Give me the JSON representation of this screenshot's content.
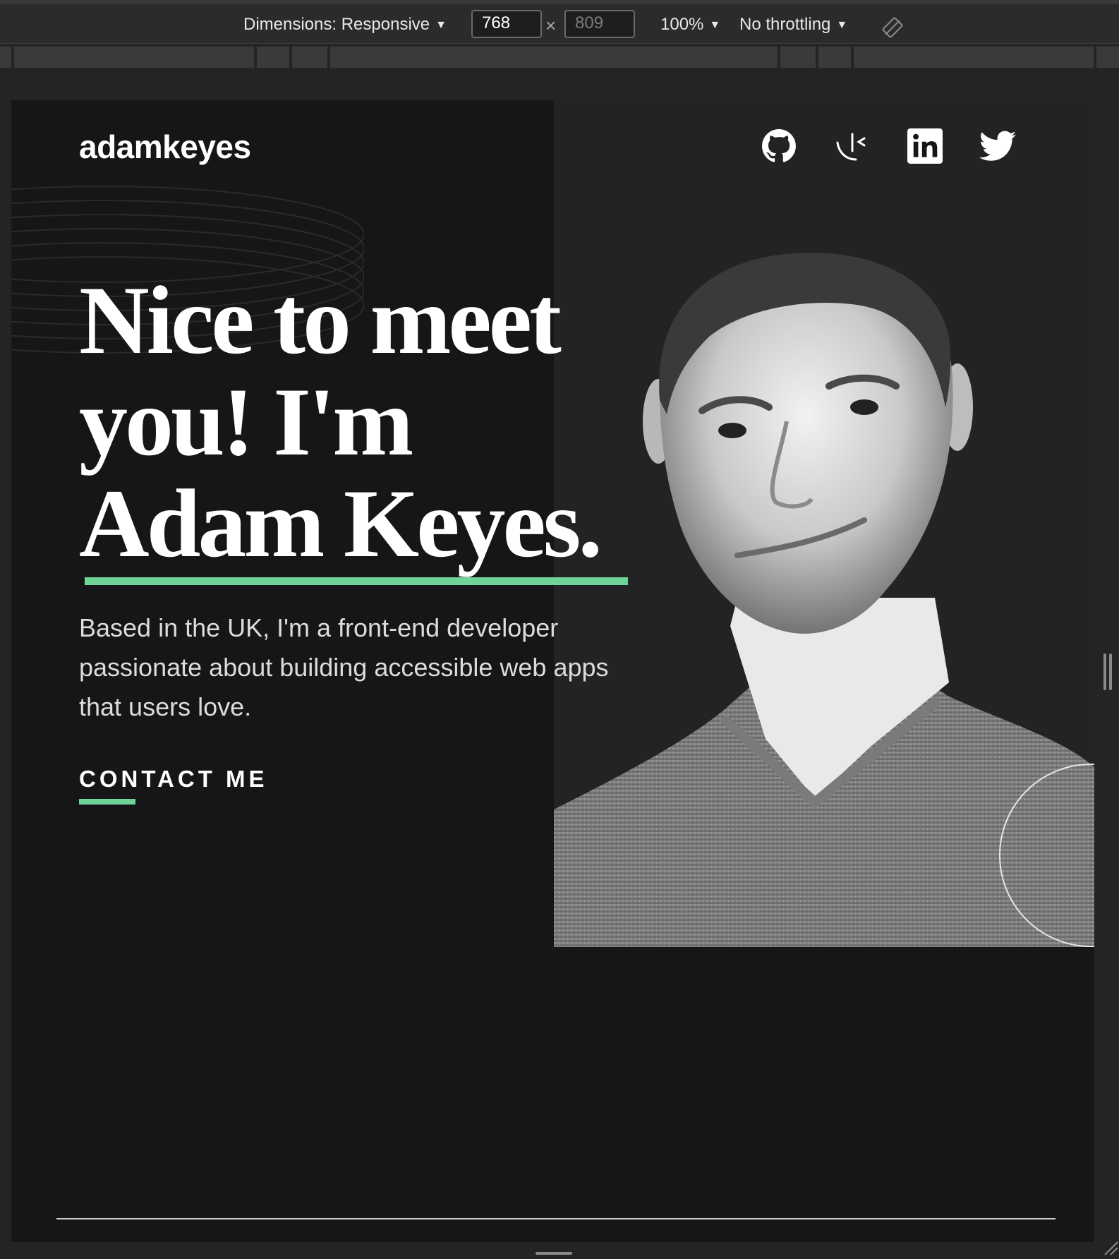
{
  "devtools": {
    "dimensions_label": "Dimensions: Responsive",
    "width_value": "768",
    "height_placeholder": "809",
    "times": "×",
    "zoom": "100%",
    "throttling": "No throttling",
    "caret": "▼",
    "rotate_icon": "rotate-icon"
  },
  "site": {
    "logo": "adamkeyes",
    "social": [
      {
        "name": "github-icon"
      },
      {
        "name": "codepen-icon"
      },
      {
        "name": "linkedin-icon"
      },
      {
        "name": "twitter-icon"
      }
    ],
    "headline": {
      "line1": "Nice to meet",
      "line2": "you! I'm",
      "line3": "Adam Keyes."
    },
    "intro": "Based in the UK, I'm a front-end developer passionate about building accessible web apps that users love.",
    "cta": "CONTACT ME",
    "colors": {
      "accent": "#6fd497",
      "background": "#161618",
      "panel": "#232325"
    }
  }
}
